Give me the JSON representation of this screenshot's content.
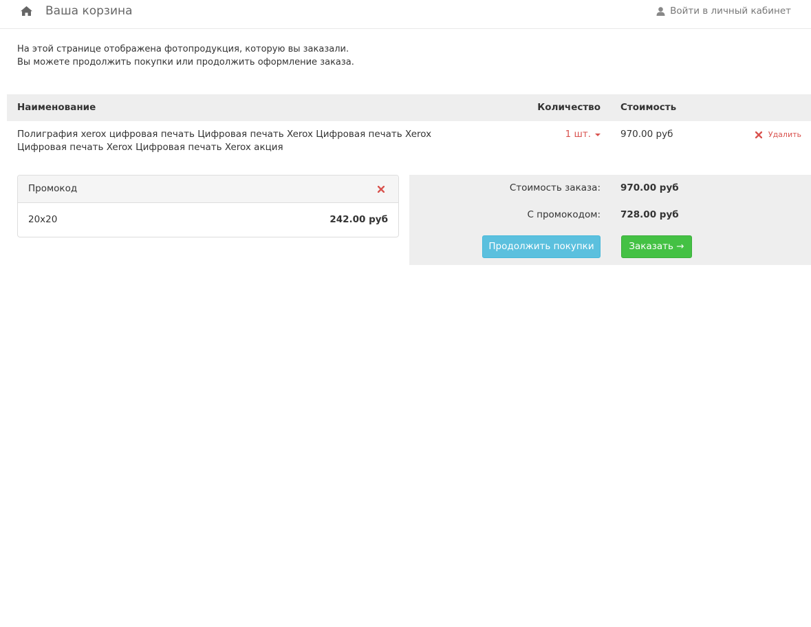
{
  "header": {
    "title": "Ваша корзина",
    "login_label": "Войти в личный кабинет",
    "home_icon": "home-icon",
    "user_icon": "user-icon"
  },
  "intro": {
    "line1": "На этой странице отображена фотопродукция, которую вы заказали.",
    "line2": "Вы можете продолжить покупки или продолжить оформление заказа."
  },
  "table": {
    "columns": {
      "name": "Наименование",
      "quantity": "Количество",
      "price": "Стоимость"
    },
    "rows": [
      {
        "name_line1": "Полиграфия xerox цифровая печать Цифровая печать Xerox Цифровая печать Xerox",
        "name_line2": "Цифровая печать Xerox Цифровая печать Xerox акция",
        "quantity": "1 шт.",
        "price": "970.00 руб",
        "delete_label": "Удалить"
      }
    ]
  },
  "promo": {
    "title": "Промокод",
    "code": "20x20",
    "amount": "242.00 руб"
  },
  "summary": {
    "order_cost_label": "Стоимость заказа:",
    "order_cost_value": "970.00 руб",
    "with_promo_label": "С промокодом:",
    "with_promo_value": "728.00 руб",
    "continue_label": "Продолжить покупки",
    "order_label": "Заказать →"
  },
  "colors": {
    "accent_red": "#d9534f",
    "info_blue": "#5bc0de",
    "success_green": "#44c144",
    "panel_gray": "#eeeeee"
  }
}
